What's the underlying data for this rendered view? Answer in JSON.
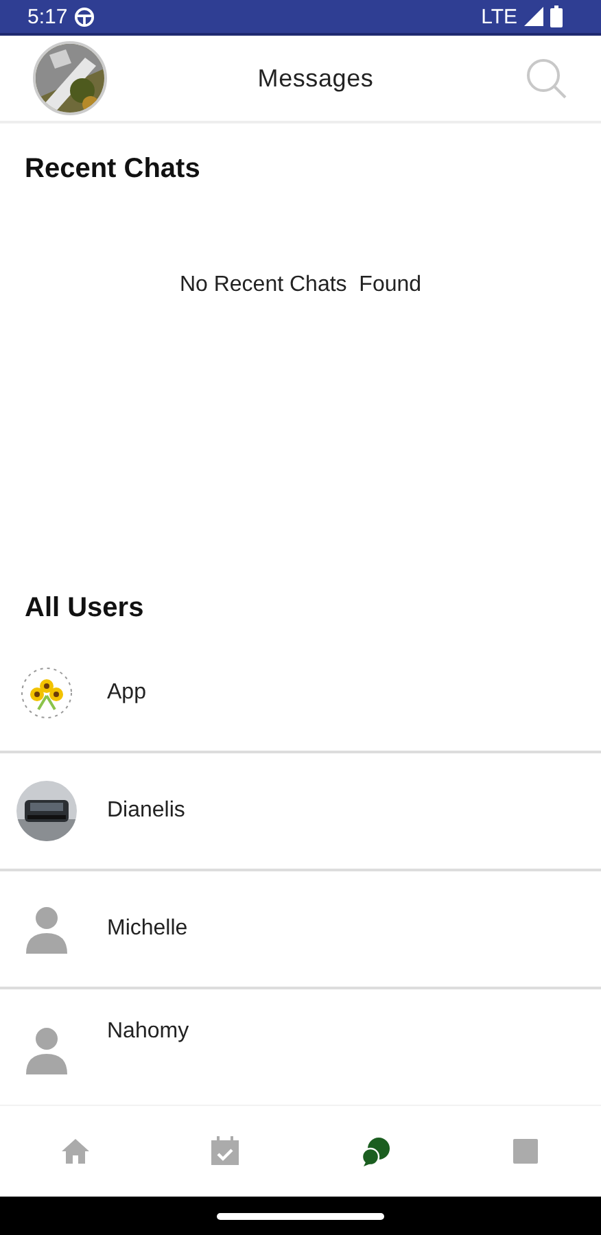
{
  "status_bar": {
    "time": "5:17",
    "network": "LTE"
  },
  "header": {
    "title": "Messages"
  },
  "recent_chats": {
    "title": "Recent Chats",
    "empty_text": "No Recent Chats  Found"
  },
  "all_users": {
    "title": "All Users",
    "users": [
      {
        "name": "App",
        "kind": "logo"
      },
      {
        "name": "Dianelis",
        "kind": "picture"
      },
      {
        "name": "Michelle",
        "kind": "default"
      },
      {
        "name": "Nahomy",
        "kind": "default"
      }
    ]
  },
  "bottom_nav": [
    {
      "kind": "home",
      "selected": false
    },
    {
      "kind": "calendar",
      "selected": false
    },
    {
      "kind": "chats",
      "selected": true
    },
    {
      "kind": "square",
      "selected": false
    }
  ]
}
